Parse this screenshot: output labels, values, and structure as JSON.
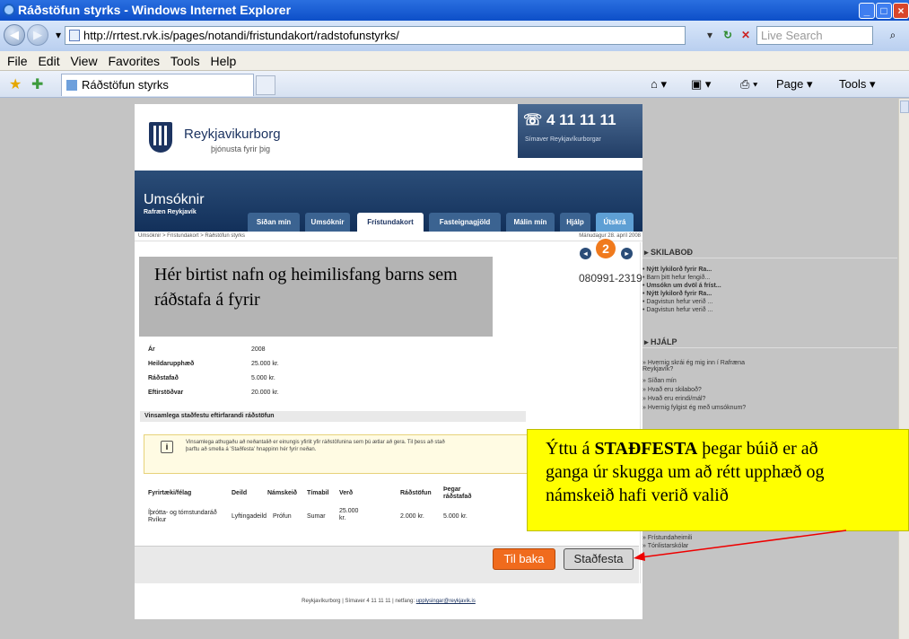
{
  "window": {
    "title": "Ráðstöfun styrks - Windows Internet Explorer"
  },
  "addressbar": {
    "url": "http://rrtest.rvk.is/pages/notandi/fristundakort/radstofunstyrks/",
    "search_placeholder": "Live Search"
  },
  "menu": [
    "File",
    "Edit",
    "View",
    "Favorites",
    "Tools",
    "Help"
  ],
  "browser_tab": {
    "title": "Ráðstöfun styrks"
  },
  "browser_tools": {
    "page": "Page ▾",
    "tools": "Tools ▾"
  },
  "site": {
    "brand": "Reykjavikurborg",
    "tagline": "þjónusta fyrir þig",
    "phone": "4 11 11 11",
    "phone_label": "Símaver Reykjavíkurborgar",
    "section_title": "Umsóknir",
    "section_sub": "Rafræn Reykjavík",
    "nav": [
      "Síðan mín",
      "Umsóknir",
      "Frístundakort",
      "Fasteignagjöld",
      "Málin mín",
      "Hjálp",
      "Útskrá"
    ],
    "breadcrumb": "Umsóknir > Frístundakort > Ráðstöfun styrks",
    "date": "Mánudagur 28. apríl 2008",
    "step_number": "2",
    "id_number": "080991-2319"
  },
  "overlay_note": "Hér birtist nafn og heimilisfang barns sem ráðstafa á fyrir",
  "summary": [
    {
      "label": "Ár",
      "value": "2008"
    },
    {
      "label": "Heildarupphæð",
      "value": "25.000 kr."
    },
    {
      "label": "Ráðstafað",
      "value": "5.000 kr."
    },
    {
      "label": "Eftirstöðvar",
      "value": "20.000 kr."
    }
  ],
  "confirm_header": "Vinsamlega staðfestu eftirfarandi ráðstöfun",
  "info": {
    "line1": "Vinsamlega athugaðu að neðantalið er einungis yfirlit yfir ráðstöfunina sem þú ætlar að gera. Til þess að stað",
    "line2": "þarftu að smella á 'Staðfesta' hnappinn hér fyrir neðan."
  },
  "table": {
    "headers": [
      "Fyrirtæki/félag",
      "Deild",
      "Námskeið",
      "Tímabil",
      "Verð",
      "Ráðstöfun",
      "Þegar ráðstafað"
    ],
    "row": [
      "Íþrótta- og tómstundaráð Rvíkur",
      "Lyftingadeild",
      "Prófun",
      "Sumar",
      "25.000 kr.",
      "2.000 kr.",
      "5.000 kr."
    ]
  },
  "sidebar": {
    "skilabod_title": "SKILABOÐ",
    "skilabod": [
      "Nýtt lykilorð fyrir Ra...",
      "Barn þitt hefur fengið...",
      "Umsókn um dvöl á fríst...",
      "Nýtt lykilorð fyrir Ra...",
      "Dagvistun hefur verið ...",
      "Dagvistun hefur verið ..."
    ],
    "hjalp_title": "HJÁLP",
    "hjalp": [
      "Hvernig skrái ég mig inn í Rafræna Reykjavík?",
      "Síðan mín",
      "Hvað eru skilaboð?",
      "Hvað eru erindi/mál?",
      "Hvernig fylgist ég með umsóknum?"
    ],
    "links": [
      "Frístundaheimili",
      "Tónlistarskólar"
    ]
  },
  "callout": {
    "line1_pre": "Ýttu á ",
    "line1_bold": "STAÐFESTA",
    "line1_post": " þegar búið er að",
    "line2": "ganga úr skugga um að rétt upphæð og",
    "line3": "námskeið hafi verið valið"
  },
  "buttons": {
    "back": "Til baka",
    "confirm": "Staðfesta"
  },
  "footer": {
    "text": "Reykjavíkurborg | Símaver 4 11 11 11 | netfang: ",
    "email": "upplysingar@reykjavik.is"
  }
}
